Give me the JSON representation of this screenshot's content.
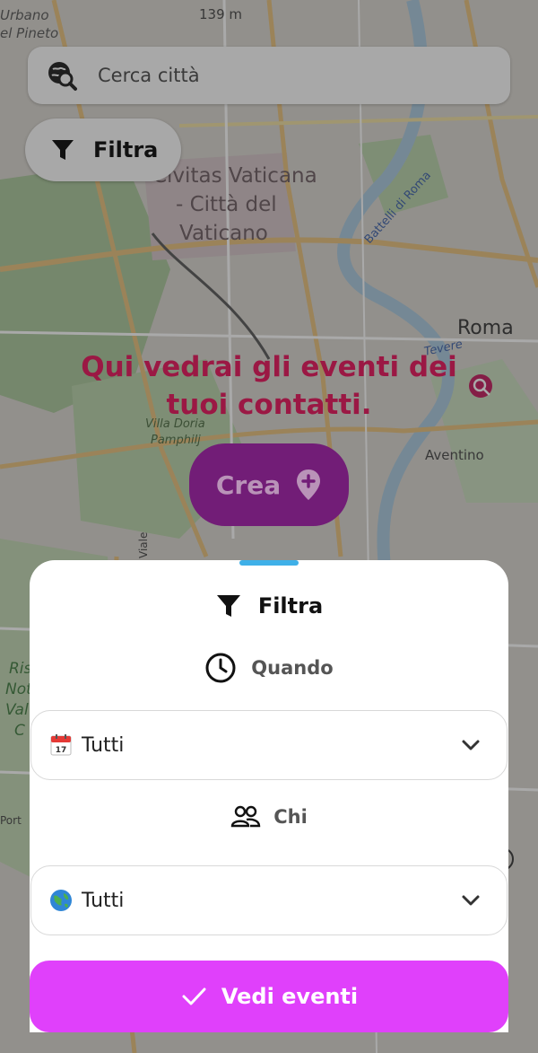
{
  "map": {
    "labels": {
      "vatican": [
        "Civitas Vaticana",
        "- Città del",
        "Vaticano"
      ],
      "roma": "Roma",
      "aventino": "Aventino",
      "villa": [
        "Villa Doria",
        "Pamphilj"
      ],
      "battelli": "Battelli di Roma",
      "tevere": "Tevere",
      "elevation": "139 m",
      "urbano": "Urbano",
      "pineto": "el Pineto",
      "viale": "Viale",
      "port": "Port",
      "riserva": [
        "Ris",
        "Not",
        "Val",
        "C"
      ]
    }
  },
  "search": {
    "placeholder": "Cerca città",
    "icon": "globe-search-icon"
  },
  "filter_chip": {
    "label": "Filtra",
    "icon": "filter-icon"
  },
  "empty_message": {
    "line1": "Qui vedrai gli eventi dei",
    "line2": "tuoi contatti."
  },
  "create_button": {
    "label": "Crea",
    "icon": "add-location-icon"
  },
  "sheet": {
    "title": "Filtra",
    "when": {
      "label": "Quando",
      "icon": "clock-icon",
      "selected": "Tutti",
      "emoji_icon": "calendar-icon"
    },
    "who": {
      "label": "Chi",
      "icon": "people-icon",
      "selected": "Tutti",
      "emoji_icon": "globe-icon"
    }
  },
  "cta": {
    "label": "Vedi eventi",
    "icon": "check-icon"
  },
  "colors": {
    "accent": "#e040fb",
    "create": "#721d77",
    "message": "#9b1844",
    "handle": "#3fb0e8"
  }
}
